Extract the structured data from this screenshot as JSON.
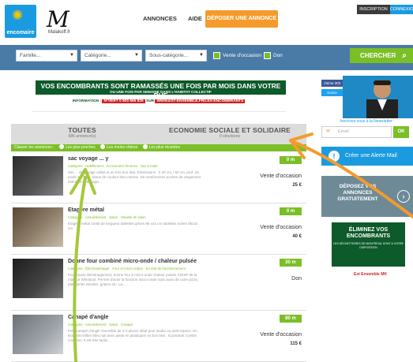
{
  "header": {
    "logo_left_text": "encomaire",
    "logo_mk_letter": "M",
    "logo_mk_sub": "Malakoff.fr",
    "nav": [
      "ANNONCES",
      "AIDE"
    ],
    "post_button": "DÉPOSER UNE ANNONCE",
    "inscription": "INSCRIPTION",
    "connexion": "CONNEXION"
  },
  "search": {
    "famille": "Famille...",
    "categorie": "Catégorie...",
    "sous_categorie": "Sous-catégorie...",
    "occasion_label": "Vente d'occasion",
    "don_label": "Don",
    "submit": "CHERCHER"
  },
  "banner": {
    "main": "VOS ENCOMBRANTS SONT RAMASSÉS UNE FOIS PAR MOIS DANS VOTRE RUE",
    "sub": "OU UNE FOIS PAR SEMAINE DANS L'HABITAT COLLECTIF",
    "info_a": "INFORMATION :",
    "info_b": "N°VERT 0 800 655 826",
    "info_c": "SUR",
    "info_d": "WWW.EST-ENSEMBLE.FR/LES-ENCOMBRANTS"
  },
  "tabs": {
    "all_title": "TOUTES",
    "all_count": "586 annonce(s)",
    "eco_title": "ECONOMIE SOCIALE ET SOLIDAIRE",
    "eco_count": "0 structures"
  },
  "sort": {
    "label": "Classer les annonces :",
    "options": [
      "Les plus proches",
      "Les moins chères",
      "Les plus récentes"
    ]
  },
  "listings": [
    {
      "title": "sac voyage ... y",
      "category": "Catégorie : Habillement · Accessoires femmes · Sac à main",
      "description": "Sac ... de voyage utilisé et en très bon état. Dimensions : h 30 cm, l 50 cm, prof. 18. poids 1,4 kg ... tissus de couleur bleu marine. De nombreuses poches de rangement intérieures. Bagage...",
      "distance": "0 m",
      "type": "Vente d'occasion",
      "price": "25 €"
    },
    {
      "title": "Etagère métal",
      "category": "Catégorie : Ameublement · Salon · Meuble de salon",
      "description": "Etagère métal 1m80 de longueur tablettes grises 95 x44 cm tablettes noires 95x32 cm",
      "distance": "0 m",
      "type": "Vente d'occasion",
      "price": "40 €"
    },
    {
      "title": "Donne four combiné micro-onde / chaleur pulsée",
      "category": "Catégorie : Électroménager · Four et micro-ondes · En état de fonctionnement",
      "description": "Pour cause déménagement, donne four à micro-onde chaleur pulsée CRISP de la marque Whirlpool. Permet d'avoir la fonction micro-onde mais aussi de cuire pizza, pâtisseries viandes, gratins etc. Le...",
      "distance": "30 m",
      "type": "Don",
      "price": ""
    },
    {
      "title": "Canapé d'angle",
      "category": "Catégorie : Ameublement · Salon · Canapé",
      "description": "Petit canapé d'angle réversible de 3-4 places idéal pour studio ou petit espace. En tissu microfibre bleu nuit avec pieds en plastiques en bon état . Il possède 2 petits coussins. Il est très facile...",
      "distance": "80 m",
      "type": "Vente d'occasion",
      "price": "115 €"
    }
  ],
  "sidebar": {
    "fb": "J'aime 303",
    "tw": "Suivre",
    "newsletter_label": "Inscrivez-vous à la Newsletter :",
    "email_placeholder": "Email",
    "ok": "OK",
    "alert": "Créer une Alerte Mail",
    "deposit": "DÉPOSEZ VOS ANNONCES GRATUITEMENT",
    "eliminez_title": "ÉLIMINEZ VOS ENCOMBRANTS",
    "eliminez_sub": "LES DÉCHETTERIES DE MONTREUIL SONT À VOTRE DISPOSITION",
    "partner": "Est Ensemble  MK"
  },
  "colors": {
    "accent_green": "#7bbf27",
    "accent_blue": "#1a9be0",
    "accent_orange": "#f49b2c",
    "search_bar": "#4a7aa6",
    "dark_green": "#0d5a2a"
  }
}
